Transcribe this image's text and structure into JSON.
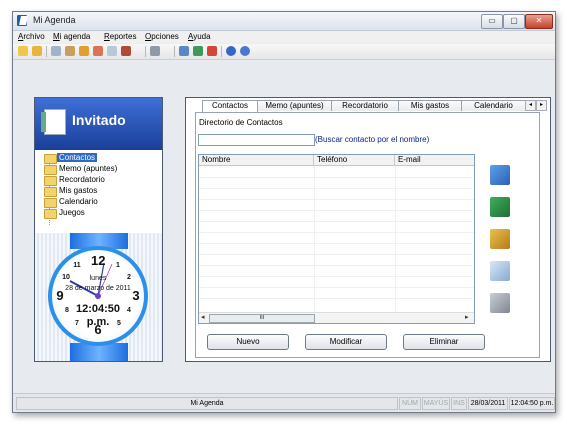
{
  "window": {
    "title": "Mi Agenda",
    "controls": {
      "minimize": "▭",
      "maximize": "▢",
      "close": "✕"
    }
  },
  "menu": [
    "Archivo",
    "Mi agenda",
    "Reportes",
    "Opciones",
    "Ayuda"
  ],
  "toolbar": {
    "icons": [
      "open-folder-icon",
      "folder-icon",
      "address-book-icon",
      "notes-icon",
      "pencil-icon",
      "home-icon",
      "document-icon",
      "book-icon",
      "print-icon",
      "notepad-icon",
      "globe-icon",
      "calculator-icon",
      "help-icon",
      "info-icon"
    ]
  },
  "user": {
    "name": "Invitado"
  },
  "nav": {
    "items": [
      "Contactos",
      "Memo (apuntes)",
      "Recordatorio",
      "Mis gastos",
      "Calendario",
      "Juegos"
    ],
    "selected": "Contactos"
  },
  "clock": {
    "day": "lunes",
    "date": "28 de marzo de 2011",
    "time": "12:04:50",
    "ampm": "p.m.",
    "numbers": [
      "12",
      "1",
      "2",
      "3",
      "4",
      "5",
      "6",
      "7",
      "8",
      "9",
      "10",
      "11"
    ]
  },
  "tabs": {
    "items": [
      "Contactos",
      "Memo (apuntes)",
      "Recordatorio",
      "Mis gastos",
      "Calendario"
    ],
    "active": "Contactos",
    "nav_left": "◂",
    "nav_right": "▸"
  },
  "contacts": {
    "heading": "Directorio de Contactos",
    "search_value": "",
    "search_link": "(Buscar contacto por el nombre)",
    "columns": [
      "Nombre",
      "Teléfono",
      "E-mail"
    ],
    "scroll_thumb": "III",
    "scroll_left": "◂",
    "scroll_right": "▸"
  },
  "side_actions": [
    "refresh-icon",
    "excel-export-icon",
    "contact-card-icon",
    "search-preview-icon",
    "print-icon"
  ],
  "buttons": {
    "new": "Nuevo",
    "modify": "Modificar",
    "delete": "Eliminar"
  },
  "status": {
    "app": "Mi Agenda",
    "num": "NÚM",
    "caps": "MAYÚS",
    "ins": "INS",
    "date": "28/03/2011",
    "time": "12:04:50 p.m."
  },
  "colors": {
    "accent": "#316ac5",
    "header_blue": "#1a3f9a",
    "clock_ring": "#2d90e8"
  }
}
